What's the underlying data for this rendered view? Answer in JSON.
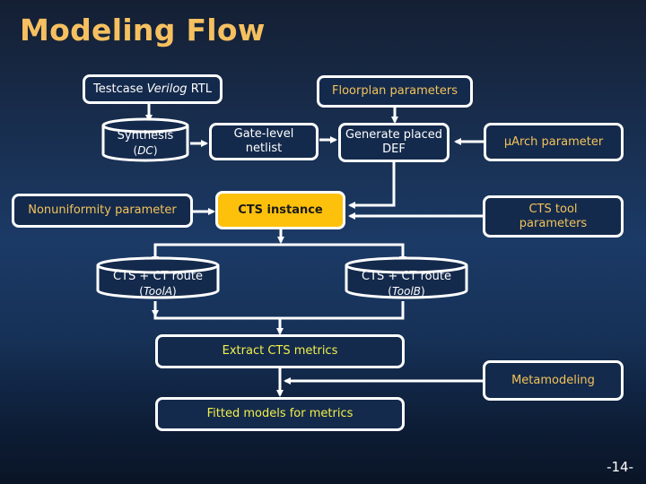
{
  "slide": {
    "title": "Modeling Flow",
    "page_number": "-14-"
  },
  "nodes": {
    "testcase": {
      "label_prefix": "Testcase ",
      "label_italic": "Verilog",
      "label_suffix": " RTL"
    },
    "floorplan": {
      "label": "Floorplan parameters"
    },
    "synthesis": {
      "label": "Synthesis",
      "tool_open": "(",
      "tool_italic": "DC",
      "tool_close": ")"
    },
    "gate_level": {
      "line1": "Gate-level",
      "line2": "netlist"
    },
    "generate_def": {
      "line1": "Generate placed",
      "line2": "DEF"
    },
    "uarch": {
      "label": "µArch parameter"
    },
    "nonuniformity": {
      "label": "Nonuniformity parameter"
    },
    "cts_instance": {
      "label": "CTS instance"
    },
    "cts_tool_params": {
      "line1": "CTS tool",
      "line2": "parameters"
    },
    "cts_route_a": {
      "label": "CTS + CT route",
      "tool_open": "(",
      "tool_italic": "ToolA",
      "tool_close": ")"
    },
    "cts_route_b": {
      "label": "CTS + CT route",
      "tool_open": "(",
      "tool_italic": "ToolB",
      "tool_close": ")"
    },
    "extract": {
      "label": "Extract CTS metrics"
    },
    "metamodeling": {
      "label": "Metamodeling"
    },
    "fitted": {
      "label": "Fitted models for metrics"
    }
  },
  "colors": {
    "title": "#f6c060",
    "highlight_fill": "#fdc10c",
    "param_text": "#f3c35a",
    "metric_text": "#f0f04a",
    "line": "#ffffff"
  }
}
